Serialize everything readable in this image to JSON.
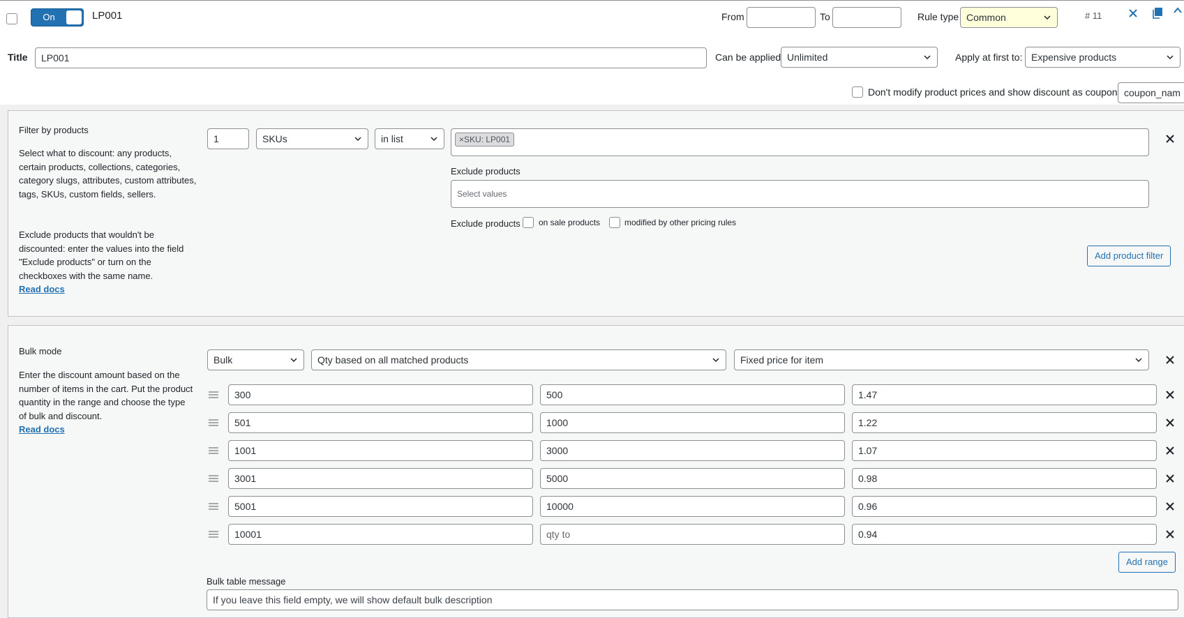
{
  "header": {
    "toggle_label": "On",
    "rule_name": "LP001",
    "from_label": "From",
    "from_value": "",
    "to_label": "To",
    "to_value": "",
    "rule_type_label": "Rule type",
    "rule_type_value": "Common",
    "rule_number": "# 11"
  },
  "title_row": {
    "title_label": "Title",
    "title_value": "LP001",
    "can_be_applied_label": "Can be applied",
    "can_be_applied_value": "Unlimited",
    "apply_first_label": "Apply at first to:",
    "apply_first_value": "Expensive products"
  },
  "coupon_row": {
    "label": "Don't modify product prices and show discount as coupon",
    "coupon_value": "coupon_nam"
  },
  "filter_panel": {
    "heading": "Filter by products",
    "desc1": "Select what to discount: any products, certain products, collections, categories, category slugs, attributes, custom attributes, tags, SKUs, custom fields, sellers.",
    "desc2": "Exclude products that wouldn't be discounted: enter the values into the field \"Exclude products\" or turn on the checkboxes with the same name.",
    "read_docs": "Read docs",
    "qty_value": "1",
    "type_value": "SKUs",
    "method_value": "in list",
    "tag_value": "SKU: LP001",
    "tag_remove": "×",
    "exclude_label": "Exclude products",
    "exclude_placeholder": "Select values",
    "exclude_checks_label": "Exclude products",
    "on_sale_label": "on sale products",
    "modified_label": "modified by other pricing rules",
    "add_filter_button": "Add product filter"
  },
  "bulk_panel": {
    "heading": "Bulk mode",
    "desc": "Enter the discount amount based on the number of items in the cart. Put the product quantity in the range and choose the type of bulk and discount.",
    "read_docs": "Read docs",
    "mode_value": "Bulk",
    "qty_basis_value": "Qty based on all matched products",
    "discount_type_value": "Fixed price for item",
    "qty_to_placeholder": "qty to",
    "ranges": [
      {
        "from": "300",
        "to": "500",
        "value": "1.47"
      },
      {
        "from": "501",
        "to": "1000",
        "value": "1.22"
      },
      {
        "from": "1001",
        "to": "3000",
        "value": "1.07"
      },
      {
        "from": "3001",
        "to": "5000",
        "value": "0.98"
      },
      {
        "from": "5001",
        "to": "10000",
        "value": "0.96"
      },
      {
        "from": "10001",
        "to": "",
        "value": "0.94"
      }
    ],
    "add_range_button": "Add range",
    "message_label": "Bulk table message",
    "message_placeholder": "If you leave this field empty, we will show default bulk description"
  },
  "colors": {
    "accent": "#2271b1",
    "rule_type_bg": "#ffffdc",
    "panel_bg": "#f6f7f7"
  }
}
